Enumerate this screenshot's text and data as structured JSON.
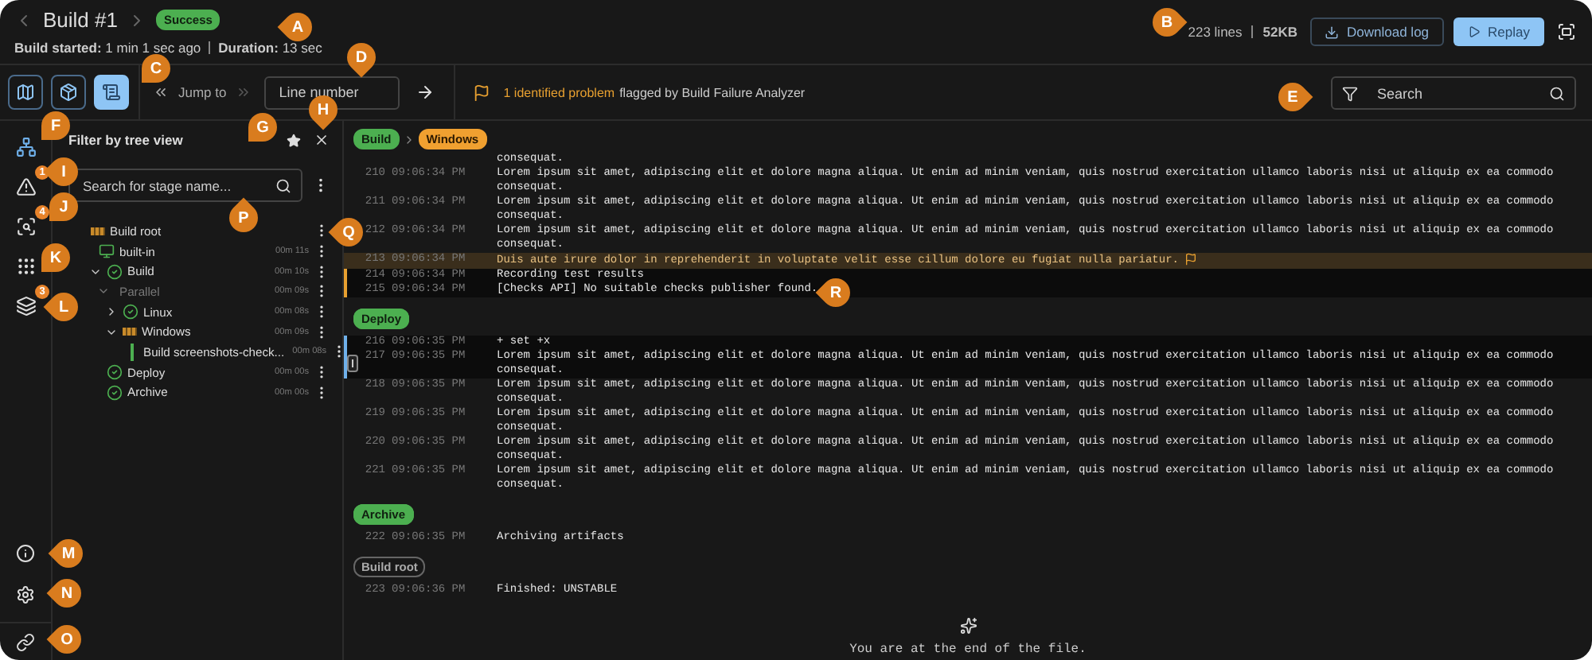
{
  "header": {
    "title": "Build #1",
    "status": {
      "label": "Success",
      "kind": "success"
    },
    "meta": [
      {
        "label": "Build started:",
        "value": "1 min 1 sec ago"
      },
      {
        "label": "Duration:",
        "value": "13 sec"
      }
    ],
    "size": {
      "lines": "223 lines",
      "bytes": "52KB"
    },
    "download": "Download log",
    "replay": "Replay"
  },
  "toolbar": {
    "views": [
      {
        "kind": "map",
        "selected": false
      },
      {
        "kind": "package",
        "selected": false
      },
      {
        "kind": "document",
        "selected": true
      }
    ],
    "jump_label": "Jump to",
    "line_field": {
      "placeholder": "Line number"
    },
    "problem": {
      "highlight": "1 identified problem",
      "rest": "flagged by Build Failure Analyzer"
    },
    "search": {
      "placeholder": "Search"
    }
  },
  "rail": {
    "top": [
      {
        "kind": "tree",
        "selected": true
      },
      {
        "kind": "warning",
        "badge": "1",
        "selected": false
      },
      {
        "kind": "inspect",
        "badge": "4",
        "selected": false
      },
      {
        "kind": "pattern",
        "selected": false
      },
      {
        "kind": "layers",
        "badge": "3",
        "selected": false
      }
    ],
    "bottom": [
      {
        "kind": "info"
      },
      {
        "kind": "settings"
      },
      {
        "kind": "link"
      }
    ]
  },
  "tree_panel": {
    "title": "Filter by tree view",
    "search": {
      "placeholder": "Search for stage name..."
    },
    "nodes": [
      {
        "label": "Build root",
        "kind": "unstable",
        "children": [
          {
            "label": "built-in",
            "time": "00m 11s",
            "kind": "agent",
            "children": [
              {
                "label": "Build",
                "time": "00m 10s",
                "kind": "success",
                "expanded": true,
                "children": [
                  {
                    "label": "Parallel",
                    "time": "00m 09s",
                    "kind": "group",
                    "expanded": true,
                    "children": [
                      {
                        "label": "Linux",
                        "time": "00m 08s",
                        "kind": "success",
                        "expanded": false
                      },
                      {
                        "label": "Windows",
                        "time": "00m 09s",
                        "kind": "unstable",
                        "expanded": true,
                        "children": [
                          {
                            "label": "Build screenshots-check...",
                            "time": "00m 08s",
                            "kind": "running"
                          }
                        ]
                      }
                    ]
                  }
                ]
              },
              {
                "label": "Deploy",
                "time": "00m 00s",
                "kind": "success"
              },
              {
                "label": "Archive",
                "time": "00m 00s",
                "kind": "success"
              }
            ]
          }
        ]
      }
    ]
  },
  "log": {
    "breadcrumb": [
      {
        "label": "Build",
        "kind": "success"
      },
      {
        "label": "Windows",
        "kind": "unstable"
      }
    ],
    "entries": [
      {
        "kind": "continuation",
        "text": "consequat."
      },
      {
        "kind": "line",
        "number": "210",
        "time": "09:06:34 PM",
        "text": "Lorem ipsum sit amet, adipiscing elit et dolore magna aliqua. Ut enim ad minim veniam, quis nostrud exercitation ullamco laboris nisi ut aliquip ex ea commodo consequat.",
        "problem": false,
        "gutter_button": false
      },
      {
        "kind": "line",
        "number": "211",
        "time": "09:06:34 PM",
        "text": "Lorem ipsum sit amet, adipiscing elit et dolore magna aliqua. Ut enim ad minim veniam, quis nostrud exercitation ullamco laboris nisi ut aliquip ex ea commodo consequat.",
        "problem": false,
        "gutter_button": false
      },
      {
        "kind": "line",
        "number": "212",
        "time": "09:06:34 PM",
        "text": "Lorem ipsum sit amet, adipiscing elit et dolore magna aliqua. Ut enim ad minim veniam, quis nostrud exercitation ullamco laboris nisi ut aliquip ex ea commodo consequat.",
        "problem": false,
        "gutter_button": false
      },
      {
        "kind": "line",
        "number": "213",
        "time": "09:06:34 PM",
        "text": "Duis aute irure dolor in reprehenderit in voluptate velit esse cillum dolore eu fugiat nulla pariatur.",
        "problem": true,
        "gutter_button": false
      },
      {
        "kind": "line",
        "number": "214",
        "time": "09:06:34 PM",
        "text": "Recording test results",
        "problem": false,
        "gutter_button": false,
        "color": "#e8a030"
      },
      {
        "kind": "line",
        "number": "215",
        "time": "09:06:34 PM",
        "text": "[Checks API] No suitable checks publisher found.",
        "problem": false,
        "gutter_button": false,
        "color": "#e8a030"
      },
      {
        "kind": "stage",
        "label": "Deploy",
        "success": true
      },
      {
        "kind": "line",
        "number": "216",
        "time": "09:06:35 PM",
        "text": "+ set +x",
        "problem": false,
        "gutter_button": false,
        "color": "#6fb0ea"
      },
      {
        "kind": "line",
        "number": "217",
        "time": "09:06:35 PM",
        "text": "Lorem ipsum sit amet, adipiscing elit et dolore magna aliqua. Ut enim ad minim veniam, quis nostrud exercitation ullamco laboris nisi ut aliquip ex ea commodo consequat.",
        "problem": false,
        "gutter_button": true,
        "color": "#6fb0ea"
      },
      {
        "kind": "line",
        "number": "218",
        "time": "09:06:35 PM",
        "text": "Lorem ipsum sit amet, adipiscing elit et dolore magna aliqua. Ut enim ad minim veniam, quis nostrud exercitation ullamco laboris nisi ut aliquip ex ea commodo consequat.",
        "problem": false,
        "gutter_button": false
      },
      {
        "kind": "line",
        "number": "219",
        "time": "09:06:35 PM",
        "text": "Lorem ipsum sit amet, adipiscing elit et dolore magna aliqua. Ut enim ad minim veniam, quis nostrud exercitation ullamco laboris nisi ut aliquip ex ea commodo consequat.",
        "problem": false,
        "gutter_button": false
      },
      {
        "kind": "line",
        "number": "220",
        "time": "09:06:35 PM",
        "text": "Lorem ipsum sit amet, adipiscing elit et dolore magna aliqua. Ut enim ad minim veniam, quis nostrud exercitation ullamco laboris nisi ut aliquip ex ea commodo consequat.",
        "problem": false,
        "gutter_button": false
      },
      {
        "kind": "line",
        "number": "221",
        "time": "09:06:35 PM",
        "text": "Lorem ipsum sit amet, adipiscing elit et dolore magna aliqua. Ut enim ad minim veniam, quis nostrud exercitation ullamco laboris nisi ut aliquip ex ea commodo consequat.",
        "problem": false,
        "gutter_button": false
      },
      {
        "kind": "stage",
        "label": "Archive",
        "success": true
      },
      {
        "kind": "line",
        "number": "222",
        "time": "09:06:35 PM",
        "text": "Archiving artifacts",
        "problem": false,
        "gutter_button": false
      },
      {
        "kind": "stage",
        "label": "Build root",
        "success": false
      },
      {
        "kind": "line",
        "number": "223",
        "time": "09:06:36 PM",
        "text": "Finished: UNSTABLE",
        "problem": false,
        "gutter_button": false
      }
    ],
    "end_message": "You are at the end of the file."
  },
  "callouts": [
    {
      "label": "A"
    },
    {
      "label": "B"
    },
    {
      "label": "C"
    },
    {
      "label": "D"
    },
    {
      "label": "E"
    },
    {
      "label": "F"
    },
    {
      "label": "G"
    },
    {
      "label": "H"
    },
    {
      "label": "I"
    },
    {
      "label": "J"
    },
    {
      "label": "K"
    },
    {
      "label": "L"
    },
    {
      "label": "M"
    },
    {
      "label": "N"
    },
    {
      "label": "O"
    },
    {
      "label": "P"
    },
    {
      "label": "Q"
    },
    {
      "label": "R"
    }
  ]
}
